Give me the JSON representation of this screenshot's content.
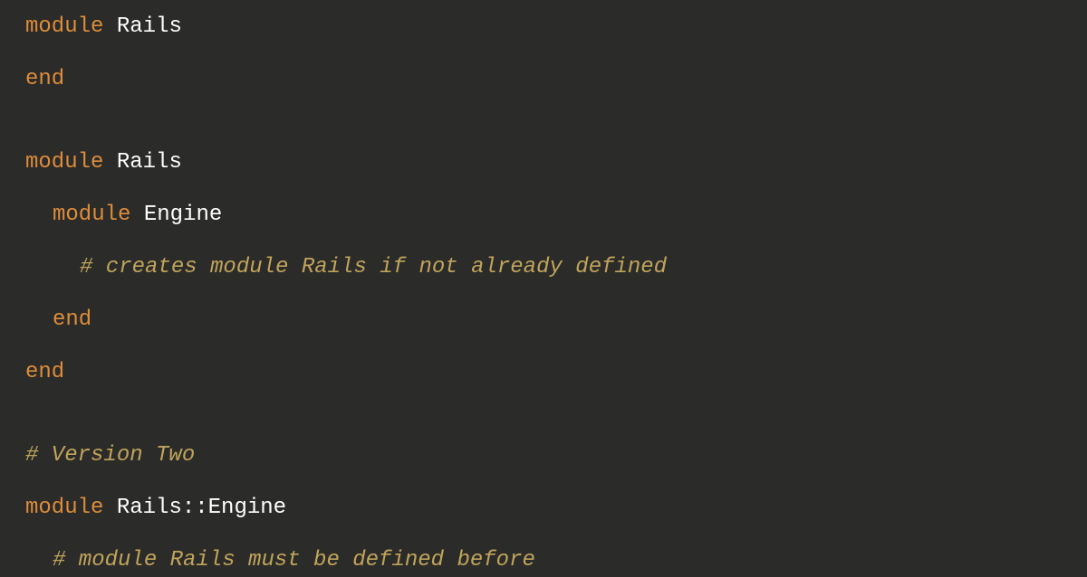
{
  "code": {
    "lines": [
      {
        "indent": 0,
        "segments": [
          {
            "type": "keyword",
            "text": "module"
          },
          {
            "type": "plain",
            "text": " "
          },
          {
            "type": "classname",
            "text": "Rails"
          }
        ]
      },
      {
        "indent": 0,
        "segments": [
          {
            "type": "keyword",
            "text": "end"
          }
        ]
      },
      {
        "blank": true
      },
      {
        "indent": 0,
        "segments": [
          {
            "type": "keyword",
            "text": "module"
          },
          {
            "type": "plain",
            "text": " "
          },
          {
            "type": "classname",
            "text": "Rails"
          }
        ]
      },
      {
        "indent": 1,
        "segments": [
          {
            "type": "keyword",
            "text": "module"
          },
          {
            "type": "plain",
            "text": " "
          },
          {
            "type": "classname",
            "text": "Engine"
          }
        ]
      },
      {
        "indent": 2,
        "segments": [
          {
            "type": "comment",
            "text": "# creates module Rails if not already defined"
          }
        ]
      },
      {
        "indent": 1,
        "segments": [
          {
            "type": "keyword",
            "text": "end"
          }
        ]
      },
      {
        "indent": 0,
        "segments": [
          {
            "type": "keyword",
            "text": "end"
          }
        ]
      },
      {
        "blank": true
      },
      {
        "indent": 0,
        "segments": [
          {
            "type": "comment",
            "text": "# Version Two"
          }
        ]
      },
      {
        "indent": 0,
        "segments": [
          {
            "type": "keyword",
            "text": "module"
          },
          {
            "type": "plain",
            "text": " "
          },
          {
            "type": "classname",
            "text": "Rails::Engine"
          }
        ]
      },
      {
        "indent": 1,
        "segments": [
          {
            "type": "comment",
            "text": "# module Rails must be defined before"
          }
        ]
      }
    ]
  }
}
